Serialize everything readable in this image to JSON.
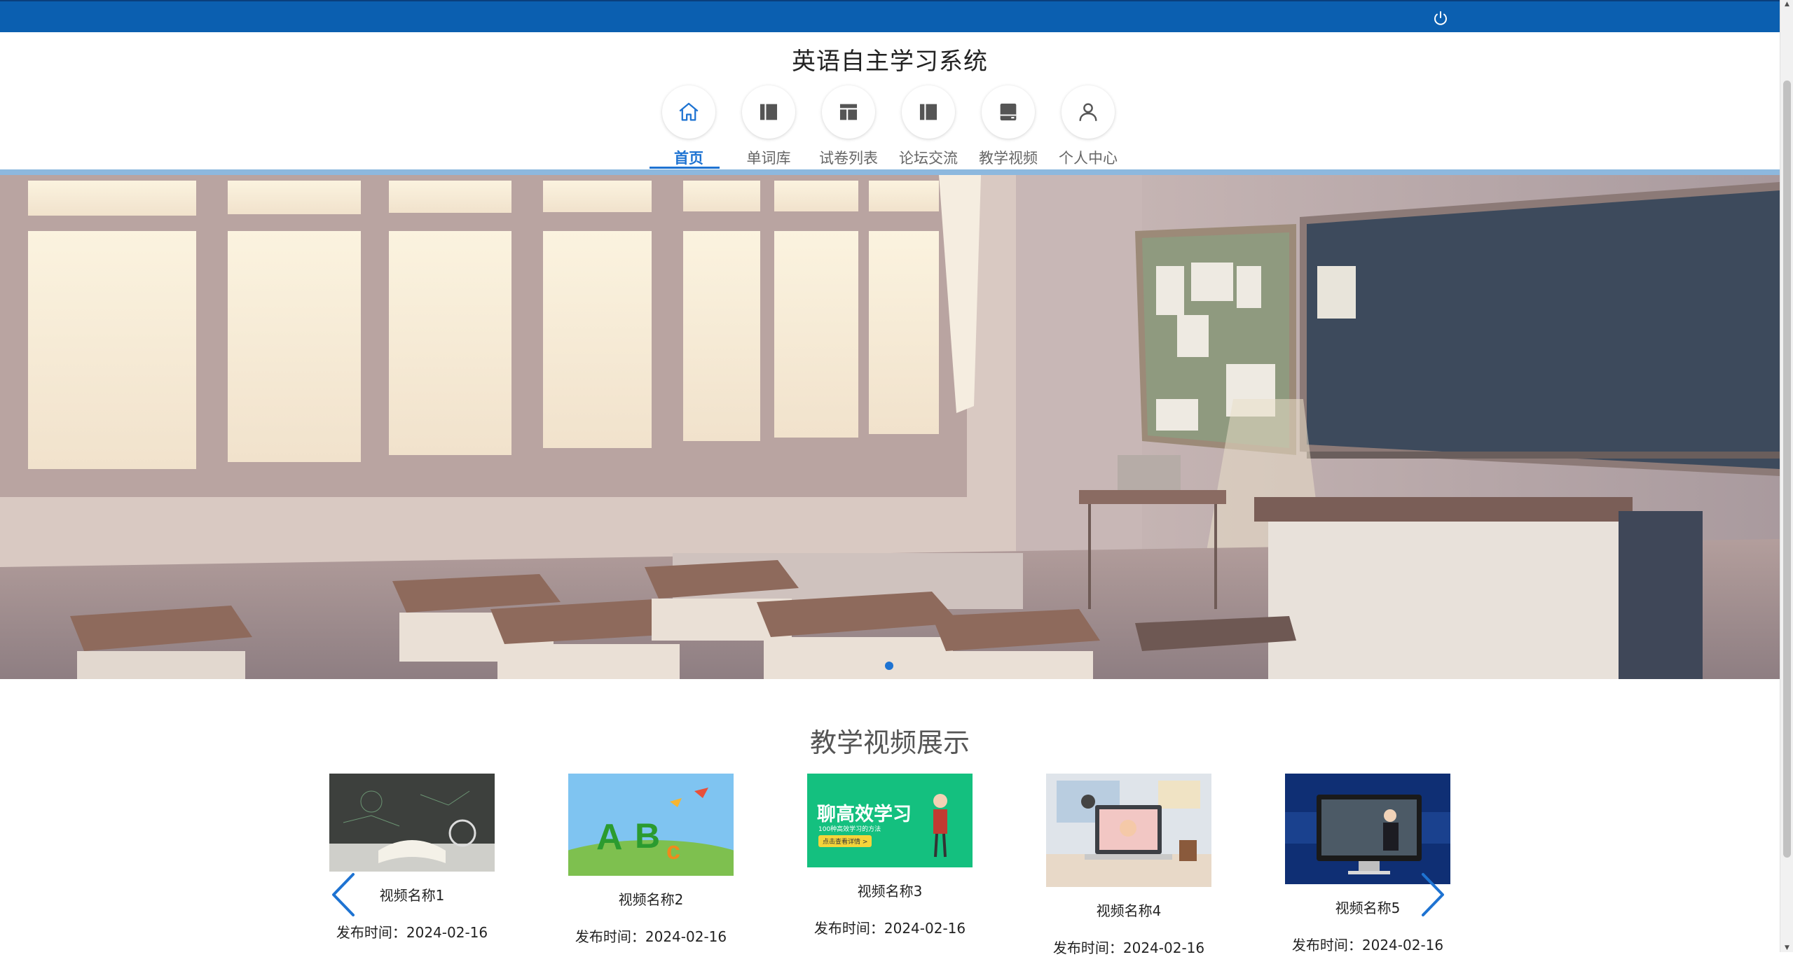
{
  "app": {
    "title": "英语自主学习系统"
  },
  "topbar": {
    "power_icon": "power-icon"
  },
  "nav": {
    "items": [
      {
        "label": "首页",
        "icon": "home-icon",
        "active": true
      },
      {
        "label": "单词库",
        "icon": "panel-icon",
        "active": false
      },
      {
        "label": "试卷列表",
        "icon": "layout-icon",
        "active": false
      },
      {
        "label": "论坛交流",
        "icon": "panel-icon",
        "active": false
      },
      {
        "label": "教学视频",
        "icon": "drive-icon",
        "active": false
      },
      {
        "label": "个人中心",
        "icon": "user-icon",
        "active": false
      }
    ]
  },
  "banner": {
    "image": "classroom illustration",
    "slide_count": 1,
    "active_slide": 1
  },
  "section": {
    "title": "教学视频展示"
  },
  "videos": [
    {
      "name": "视频名称1",
      "date_label": "发布时间：",
      "date": "2024-02-16"
    },
    {
      "name": "视频名称2",
      "date_label": "发布时间：",
      "date": "2024-02-16"
    },
    {
      "name": "视频名称3",
      "date_label": "发布时间：",
      "date": "2024-02-16",
      "thumb_text": "聊高效学习",
      "thumb_subtext": "100种高效学习的方法",
      "thumb_button": "点击查看详情 >"
    },
    {
      "name": "视频名称4",
      "date_label": "发布时间：",
      "date": "2024-02-16"
    },
    {
      "name": "视频名称5",
      "date_label": "发布时间：",
      "date": "2024-02-16"
    }
  ],
  "colors": {
    "topbar": "#0b5fb0",
    "accent": "#1e73d2",
    "divider": "#8db8de"
  }
}
